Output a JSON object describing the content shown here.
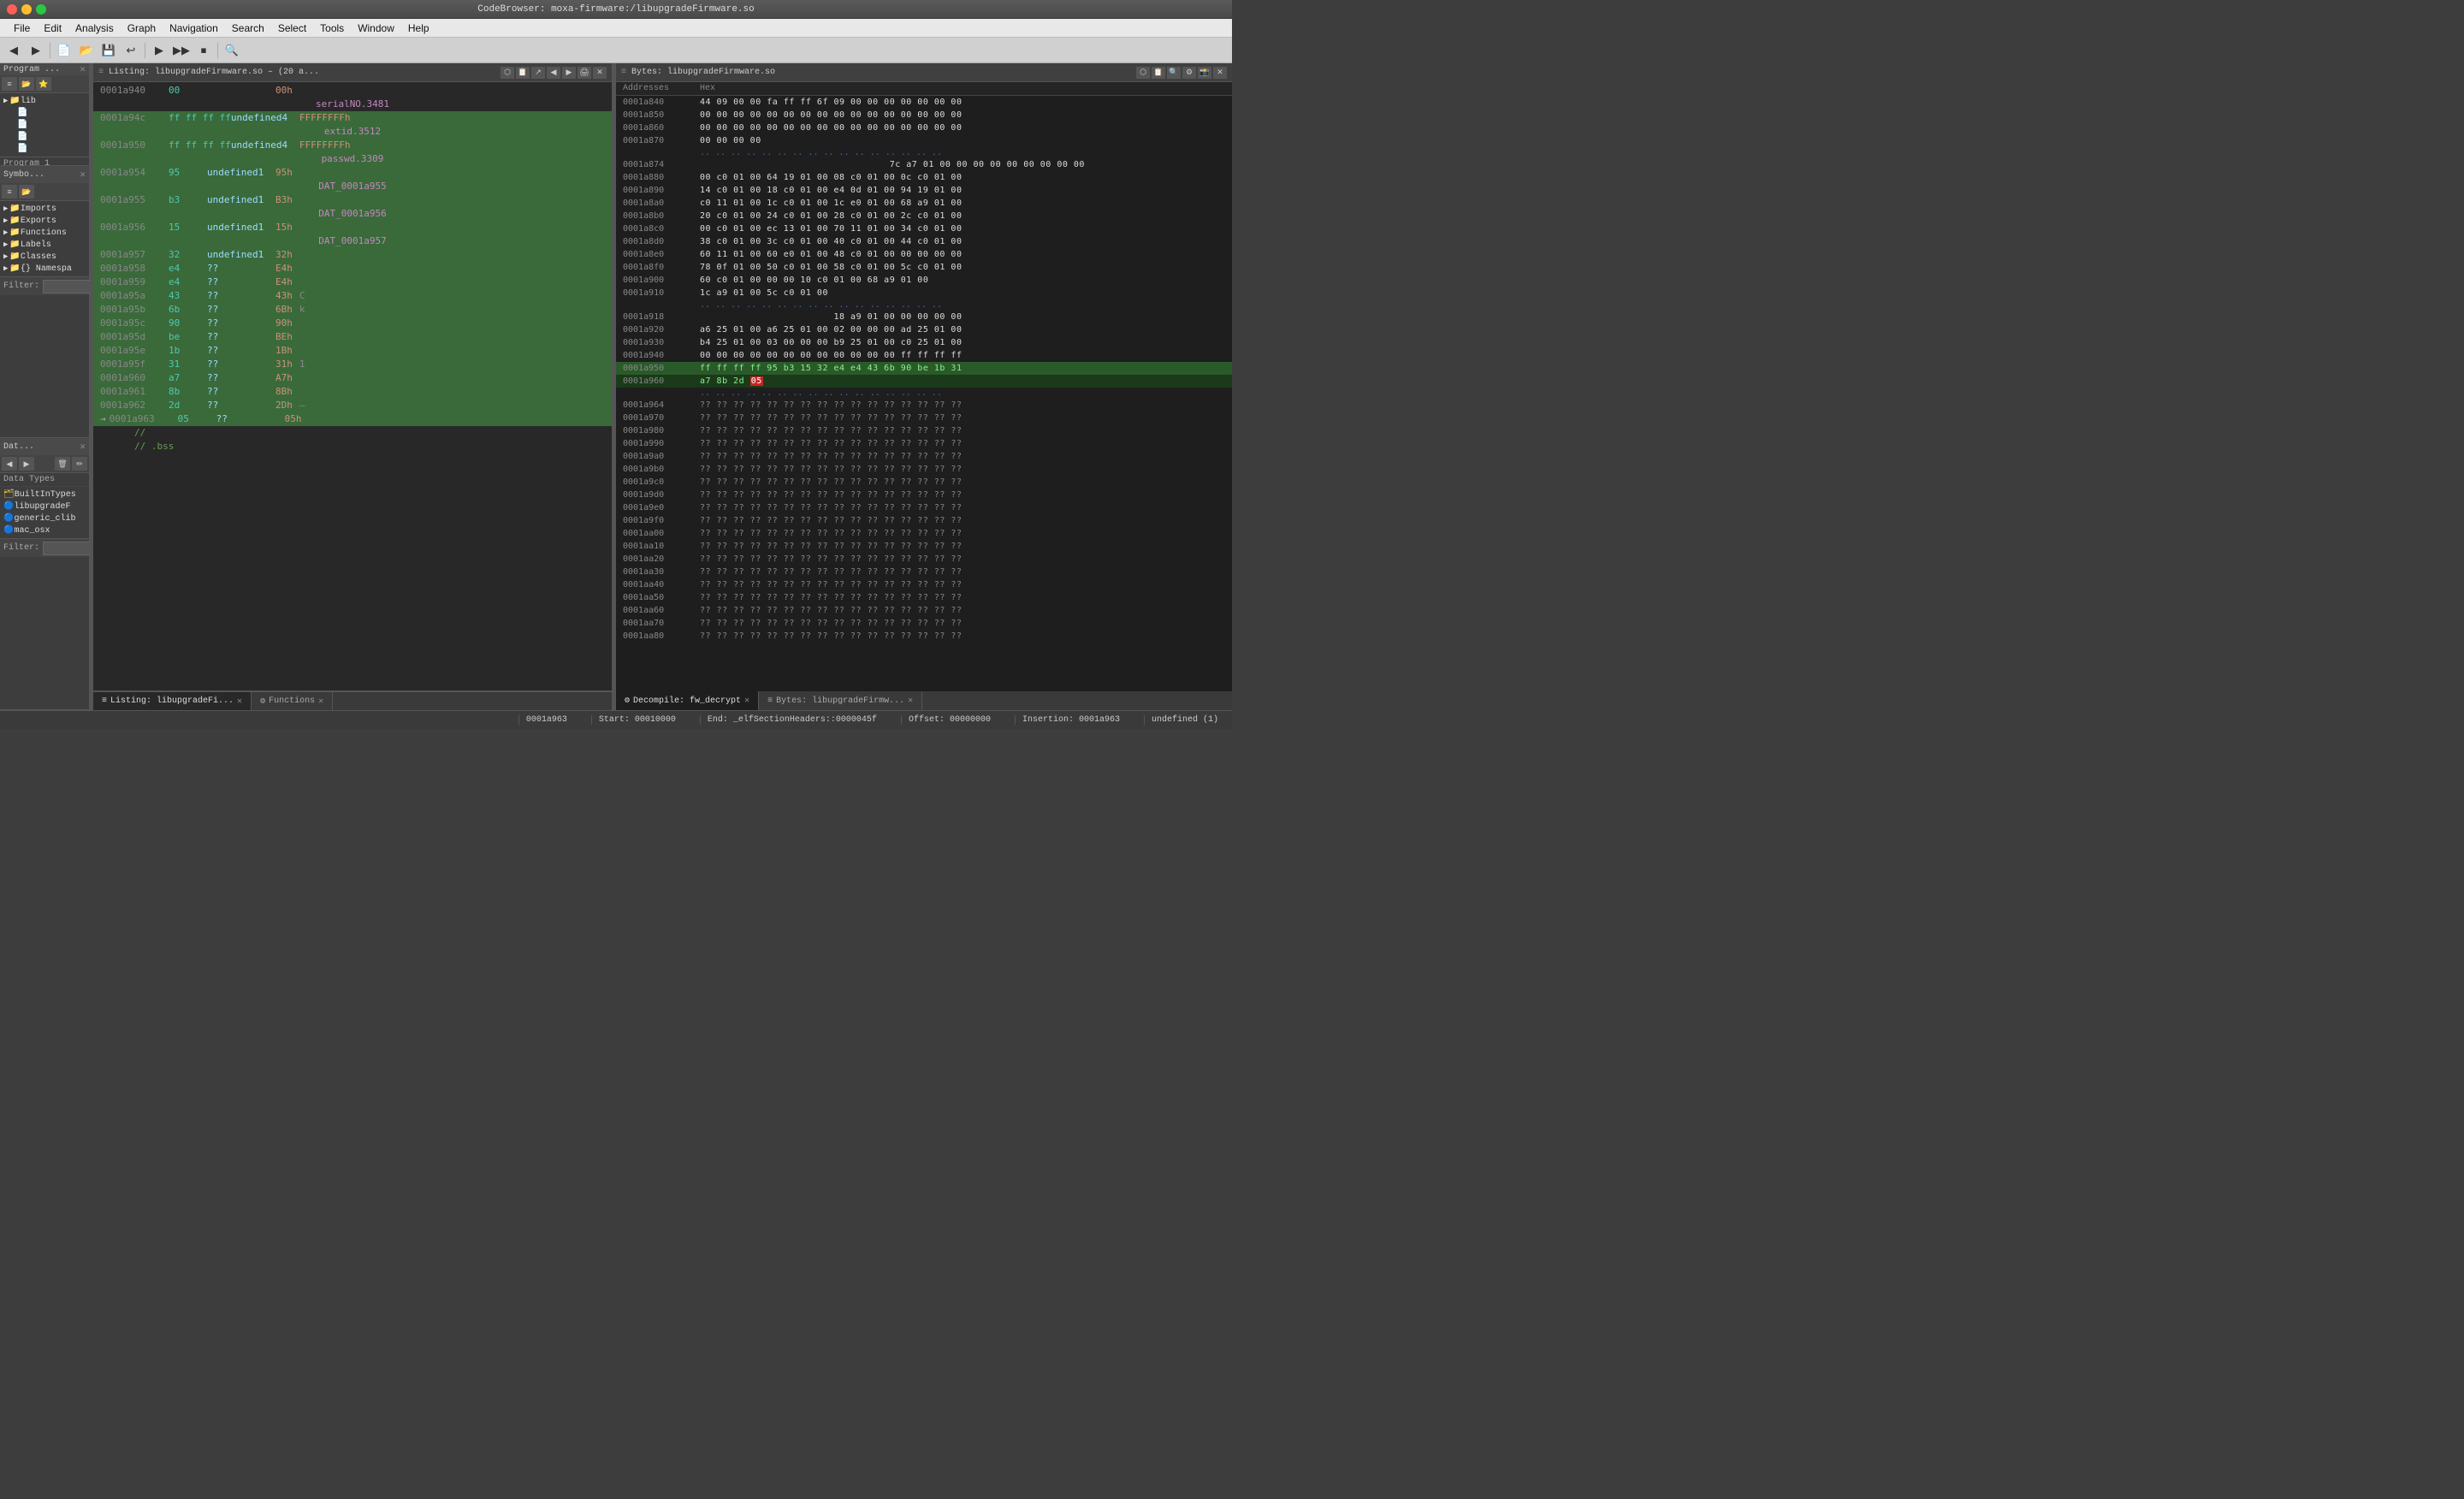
{
  "titleBar": {
    "title": "CodeBrowser: moxa-firmware:/libupgradeFirmware.so"
  },
  "menuBar": {
    "items": [
      "File",
      "Edit",
      "Analysis",
      "Graph",
      "Navigation",
      "Search",
      "Select",
      "Tools",
      "Window",
      "Help"
    ]
  },
  "leftPanel": {
    "programPanel": {
      "title": "Program ...",
      "tabLabel": "Program 1"
    },
    "symbolPanel": {
      "title": "Symbo...",
      "treeItems": [
        {
          "label": "lib",
          "type": "folder",
          "expanded": true
        },
        {
          "label": "Imports",
          "type": "folder"
        },
        {
          "label": "Exports",
          "type": "folder"
        },
        {
          "label": "Functions",
          "type": "folder"
        },
        {
          "label": "Labels",
          "type": "folder"
        },
        {
          "label": "Classes",
          "type": "folder"
        },
        {
          "label": "Namespa",
          "type": "folder"
        }
      ]
    },
    "dataPanel": {
      "title": "Dat...",
      "treeItems": [
        {
          "label": "BuiltInTypes",
          "type": "file"
        },
        {
          "label": "libupgradeF",
          "type": "file"
        },
        {
          "label": "generic_clib",
          "type": "file"
        },
        {
          "label": "mac_osx",
          "type": "file"
        }
      ]
    },
    "filterLabel": "Filter:"
  },
  "listingPanel": {
    "title": "Listing: libupgradeFirmware.so – (20 a...",
    "rows": [
      {
        "addr": "0001a940",
        "hex": "00",
        "type": "",
        "val": "",
        "extra": "00h",
        "indent": 0
      },
      {
        "addr": "",
        "hex": "",
        "type": "",
        "val": "",
        "label": "serialNO.3481",
        "indent": 0
      },
      {
        "addr": "0001a94c",
        "hex": "ff ff ff ff",
        "type": "undefined4",
        "val": "FFFFFFFFh",
        "extra": "",
        "indent": 0
      },
      {
        "addr": "",
        "hex": "",
        "type": "",
        "val": "",
        "label": "extid.3512",
        "indent": 0
      },
      {
        "addr": "0001a950",
        "hex": "ff ff ff ff",
        "type": "undefined4",
        "val": "FFFFFFFFh",
        "extra": "",
        "indent": 0
      },
      {
        "addr": "",
        "hex": "",
        "type": "",
        "val": "",
        "label": "passwd.3309",
        "indent": 0
      },
      {
        "addr": "0001a954",
        "hex": "95",
        "type": "undefined1",
        "val": "95h",
        "extra": "",
        "indent": 0
      },
      {
        "addr": "",
        "hex": "",
        "type": "",
        "val": "",
        "label": "DAT_0001a955",
        "indent": 0
      },
      {
        "addr": "0001a955",
        "hex": "b3",
        "type": "undefined1",
        "val": "B3h",
        "extra": "",
        "indent": 0
      },
      {
        "addr": "",
        "hex": "",
        "type": "",
        "val": "",
        "label": "DAT_0001a956",
        "indent": 0
      },
      {
        "addr": "0001a956",
        "hex": "15",
        "type": "undefined1",
        "val": "15h",
        "extra": "",
        "indent": 0
      },
      {
        "addr": "",
        "hex": "",
        "type": "",
        "val": "",
        "label": "DAT_0001a957",
        "indent": 0
      },
      {
        "addr": "0001a957",
        "hex": "32",
        "type": "undefined1",
        "val": "32h",
        "extra": "",
        "indent": 0
      },
      {
        "addr": "0001a958",
        "hex": "e4",
        "type": "??",
        "val": "E4h",
        "extra": "",
        "indent": 0
      },
      {
        "addr": "0001a959",
        "hex": "e4",
        "type": "??",
        "val": "E4h",
        "extra": "",
        "indent": 0
      },
      {
        "addr": "0001a95a",
        "hex": "43",
        "type": "??",
        "val": "43h",
        "extra": "C",
        "indent": 0
      },
      {
        "addr": "0001a95b",
        "hex": "6b",
        "type": "??",
        "val": "6Bh",
        "extra": "k",
        "indent": 0
      },
      {
        "addr": "0001a95c",
        "hex": "90",
        "type": "??",
        "val": "90h",
        "extra": "",
        "indent": 0
      },
      {
        "addr": "0001a95d",
        "hex": "be",
        "type": "??",
        "val": "BEh",
        "extra": "",
        "indent": 0
      },
      {
        "addr": "0001a95e",
        "hex": "1b",
        "type": "??",
        "val": "1Bh",
        "extra": "",
        "indent": 0
      },
      {
        "addr": "0001a95f",
        "hex": "31",
        "type": "??",
        "val": "31h",
        "extra": "1",
        "indent": 0
      },
      {
        "addr": "0001a960",
        "hex": "a7",
        "type": "??",
        "val": "A7h",
        "extra": "",
        "indent": 0
      },
      {
        "addr": "0001a961",
        "hex": "8b",
        "type": "??",
        "val": "8Bh",
        "extra": "",
        "indent": 0
      },
      {
        "addr": "0001a962",
        "hex": "2d",
        "type": "??",
        "val": "2Dh",
        "extra": "–",
        "indent": 0
      },
      {
        "addr": "0001a963",
        "hex": "05",
        "type": "??",
        "val": "05h",
        "extra": "",
        "indent": 0
      },
      {
        "addr": "",
        "hex": "",
        "type": "//",
        "val": "",
        "extra": "",
        "indent": 0
      },
      {
        "addr": "",
        "hex": "",
        "type": "// .bss",
        "val": "",
        "extra": "",
        "indent": 0
      }
    ],
    "tabs": [
      {
        "label": "Listing: libupgradeFi...",
        "active": true
      },
      {
        "label": "Functions",
        "active": false
      }
    ]
  },
  "bytesPanel": {
    "title": "Bytes: libupgradeFirmware.so",
    "columns": [
      "Addresses",
      "Hex"
    ],
    "rows": [
      {
        "addr": "0001a840",
        "hex": "44 09 00 00 fa ff ff 6f 09 00 00 00 00 00 00 00",
        "highlight": "none"
      },
      {
        "addr": "0001a850",
        "hex": "00 00 00 00 00 00 00 00 00 00 00 00 00 00 00 00",
        "highlight": "none"
      },
      {
        "addr": "0001a860",
        "hex": "00 00 00 00 00 00 00 00 00 00 00 00 00 00 00 00",
        "highlight": "none"
      },
      {
        "addr": "0001a870",
        "hex": "00 00 00 00",
        "highlight": "none"
      },
      {
        "addr": "0001a874",
        "dotted": true
      },
      {
        "addr": "0001a874",
        "hex": "                                7c a7 01 00 00 00 00 00 00 00 00 00",
        "highlight": "none"
      },
      {
        "addr": "0001a880",
        "hex": "00 c0 01 00 64 19 01 00 08 c0 01 00 0c c0 01 00",
        "highlight": "none"
      },
      {
        "addr": "0001a890",
        "hex": "14 c0 01 00 18 c0 01 00 e4 0d 01 00 94 19 01 00",
        "highlight": "none"
      },
      {
        "addr": "0001a8a0",
        "hex": "c0 11 01 00 1c c0 01 00 1c e0 01 00 68 a9 01 00",
        "highlight": "none"
      },
      {
        "addr": "0001a8b0",
        "hex": "20 c0 01 00 24 c0 01 00 28 c0 01 00 2c c0 01 00",
        "highlight": "none"
      },
      {
        "addr": "0001a8c0",
        "hex": "00 c0 01 00 ec 13 01 00 70 11 01 00 34 c0 01 00",
        "highlight": "none"
      },
      {
        "addr": "0001a8d0",
        "hex": "38 c0 01 00 3c c0 01 00 40 c0 01 00 44 c0 01 00",
        "highlight": "none"
      },
      {
        "addr": "0001a8e0",
        "hex": "60 11 01 00 60 e0 01 00 48 c0 01 00 00 00 00 00",
        "highlight": "none"
      },
      {
        "addr": "0001a8f0",
        "hex": "78 0f 01 00 50 c0 01 00 58 c0 01 00 5c c0 01 00",
        "highlight": "none"
      },
      {
        "addr": "0001a900",
        "hex": "60 c0 01 00 00 00 10 c0 01 00 68 a9 01 00",
        "highlight": "none"
      },
      {
        "addr": "0001a910",
        "hex": "1c a9 01 00 5c c0 01 00",
        "highlight": "none"
      },
      {
        "addr": "0001a918",
        "dotted": true
      },
      {
        "addr": "0001a918",
        "hex": "                          18 a9 01 00 00 00 00 00",
        "highlight": "none"
      },
      {
        "addr": "0001a920",
        "hex": "a6 25 01 00 a6 25 01 00 02 00 00 00 ad 25 01 00",
        "highlight": "none"
      },
      {
        "addr": "0001a930",
        "hex": "b4 25 01 00 03 00 00 00 b9 25 01 00 c0 25 01 00",
        "highlight": "none"
      },
      {
        "addr": "0001a940",
        "hex": "00 00 00 00 00 00 00 00 00 00 00 00 ff ff ff ff",
        "highlight": "none"
      },
      {
        "addr": "0001a950",
        "hex": "ff ff ff ff 95 b3 15 32 e4 e4 43 6b 90 be 1b 31",
        "highlight": "green"
      },
      {
        "addr": "0001a960",
        "hex": "a7 8b 2d 05",
        "highlight": "partial",
        "cursor": 3
      },
      {
        "addr": "0001a964",
        "dotted": true
      },
      {
        "addr": "0001a964",
        "hex": "?? ?? ?? ?? ?? ?? ?? ?? ?? ?? ?? ?? ?? ?? ?? ??",
        "highlight": "none"
      },
      {
        "addr": "0001a970",
        "hex": "?? ?? ?? ?? ?? ?? ?? ?? ?? ?? ?? ?? ?? ?? ?? ??",
        "highlight": "none"
      },
      {
        "addr": "0001a980",
        "hex": "?? ?? ?? ?? ?? ?? ?? ?? ?? ?? ?? ?? ?? ?? ?? ??",
        "highlight": "none"
      },
      {
        "addr": "0001a990",
        "hex": "?? ?? ?? ?? ?? ?? ?? ?? ?? ?? ?? ?? ?? ?? ?? ??",
        "highlight": "none"
      },
      {
        "addr": "0001a9a0",
        "hex": "?? ?? ?? ?? ?? ?? ?? ?? ?? ?? ?? ?? ?? ?? ?? ??",
        "highlight": "none"
      },
      {
        "addr": "0001a9b0",
        "hex": "?? ?? ?? ?? ?? ?? ?? ?? ?? ?? ?? ?? ?? ?? ?? ??",
        "highlight": "none"
      },
      {
        "addr": "0001a9c0",
        "hex": "?? ?? ?? ?? ?? ?? ?? ?? ?? ?? ?? ?? ?? ?? ?? ??",
        "highlight": "none"
      },
      {
        "addr": "0001a9d0",
        "hex": "?? ?? ?? ?? ?? ?? ?? ?? ?? ?? ?? ?? ?? ?? ?? ??",
        "highlight": "none"
      },
      {
        "addr": "0001a9e0",
        "hex": "?? ?? ?? ?? ?? ?? ?? ?? ?? ?? ?? ?? ?? ?? ?? ??",
        "highlight": "none"
      },
      {
        "addr": "0001a9f0",
        "hex": "?? ?? ?? ?? ?? ?? ?? ?? ?? ?? ?? ?? ?? ?? ?? ??",
        "highlight": "none"
      },
      {
        "addr": "0001aa00",
        "hex": "?? ?? ?? ?? ?? ?? ?? ?? ?? ?? ?? ?? ?? ?? ?? ??",
        "highlight": "none"
      },
      {
        "addr": "0001aa10",
        "hex": "?? ?? ?? ?? ?? ?? ?? ?? ?? ?? ?? ?? ?? ?? ?? ??",
        "highlight": "none"
      },
      {
        "addr": "0001aa20",
        "hex": "?? ?? ?? ?? ?? ?? ?? ?? ?? ?? ?? ?? ?? ?? ?? ??",
        "highlight": "none"
      },
      {
        "addr": "0001aa30",
        "hex": "?? ?? ?? ?? ?? ?? ?? ?? ?? ?? ?? ?? ?? ?? ?? ??",
        "highlight": "none"
      },
      {
        "addr": "0001aa40",
        "hex": "?? ?? ?? ?? ?? ?? ?? ?? ?? ?? ?? ?? ?? ?? ?? ??",
        "highlight": "none"
      },
      {
        "addr": "0001aa50",
        "hex": "?? ?? ?? ?? ?? ?? ?? ?? ?? ?? ?? ?? ?? ?? ?? ??",
        "highlight": "none"
      },
      {
        "addr": "0001aa60",
        "hex": "?? ?? ?? ?? ?? ?? ?? ?? ?? ?? ?? ?? ?? ?? ?? ??",
        "highlight": "none"
      },
      {
        "addr": "0001aa70",
        "hex": "?? ?? ?? ?? ?? ?? ?? ?? ?? ?? ?? ?? ?? ?? ?? ??",
        "highlight": "none"
      },
      {
        "addr": "0001aa80",
        "hex": "?? ?? ?? ?? ?? ?? ?? ?? ?? ?? ?? ?? ?? ?? ?? ??",
        "highlight": "none"
      }
    ],
    "bottomTabs": [
      {
        "label": "Decompile: fw_decrypt",
        "active": true
      },
      {
        "label": "Bytes: libupgradeFirmw...",
        "active": false
      }
    ]
  },
  "statusBar": {
    "start": "Start: 00010000",
    "end": "End: _elfSectionHeaders::0000045f",
    "offset": "Offset: 00000000",
    "insertion": "Insertion: 0001a963",
    "leftStatus": "",
    "addr": "0001a963",
    "type": "undefined (1)"
  }
}
